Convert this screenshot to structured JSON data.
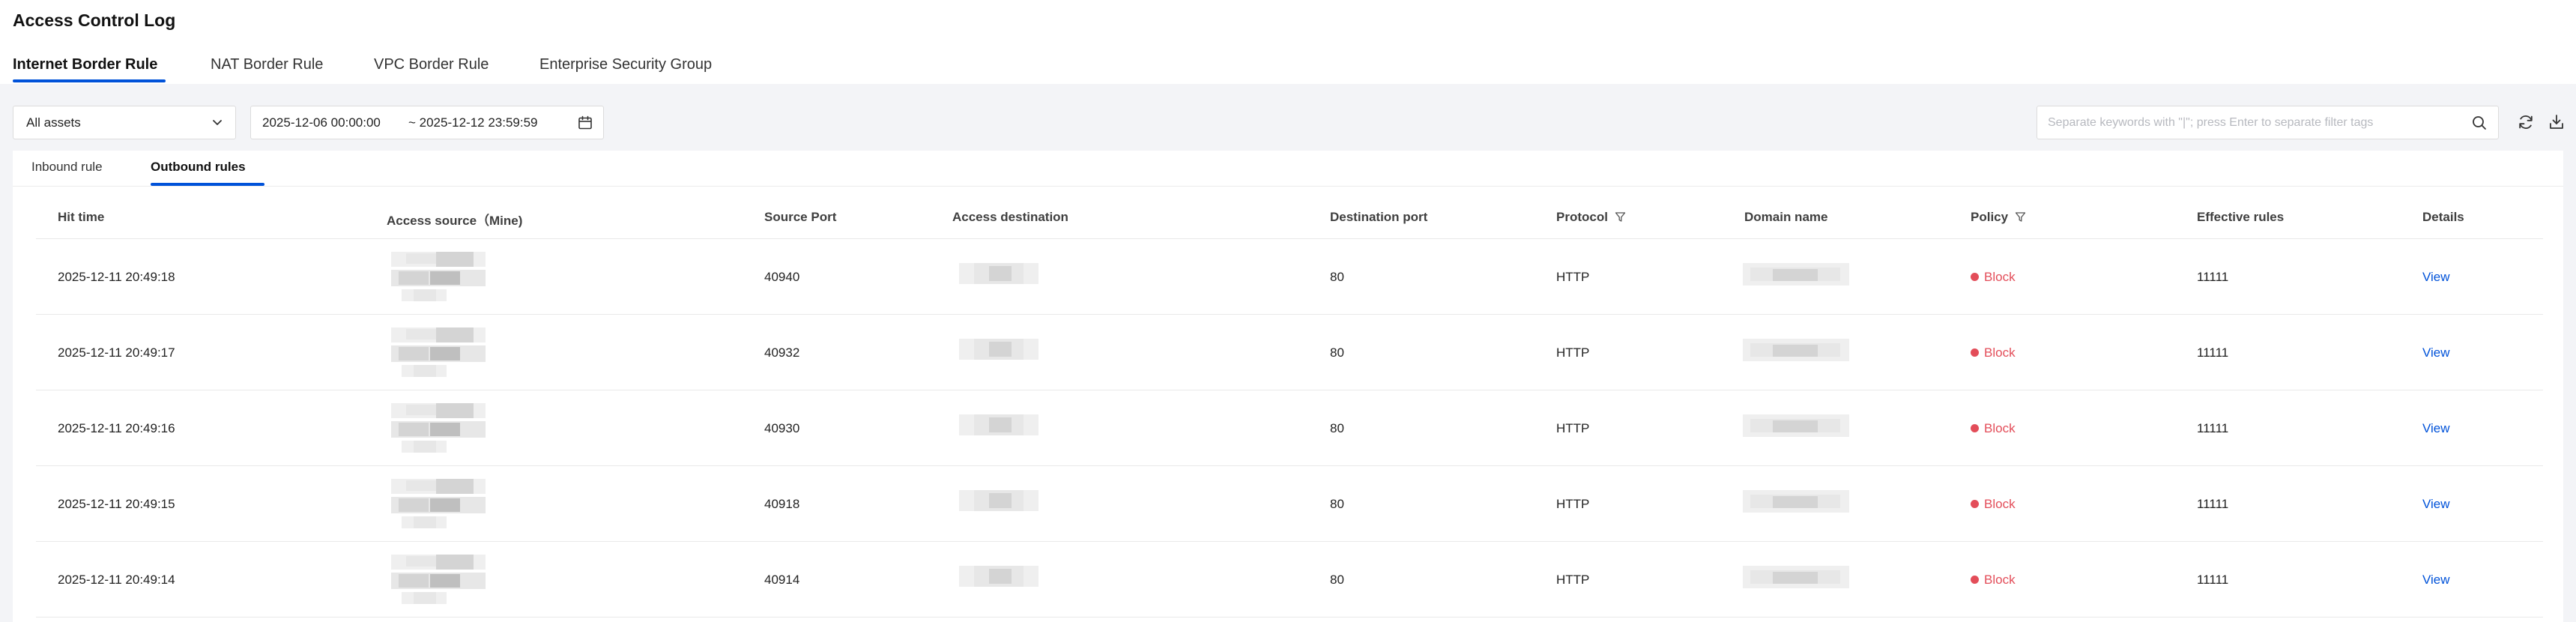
{
  "page": {
    "title": "Access Control Log"
  },
  "main_tabs": [
    {
      "label": "Internet Border Rule",
      "active": true
    },
    {
      "label": "NAT Border Rule",
      "active": false
    },
    {
      "label": "VPC Border Rule",
      "active": false
    },
    {
      "label": "Enterprise Security Group",
      "active": false
    }
  ],
  "toolbar": {
    "asset_select": "All assets",
    "date_start": "2025-12-06 00:00:00",
    "date_end": "~ 2025-12-12 23:59:59",
    "search_placeholder": "Separate keywords with \"|\"; press Enter to separate filter tags",
    "search_value": ""
  },
  "sub_tabs": [
    {
      "label": "Inbound rule",
      "active": false
    },
    {
      "label": "Outbound rules",
      "active": true
    }
  ],
  "table": {
    "columns": [
      "Hit time",
      "Access source（Mine)",
      "Source Port",
      "Access destination",
      "Destination port",
      "Protocol",
      "Domain name",
      "Policy",
      "Effective rules",
      "Details"
    ],
    "rows": [
      {
        "hit_time": "2025-12-11 20:49:18",
        "source_port": "40940",
        "dest_port": "80",
        "protocol": "HTTP",
        "policy": "Block",
        "rule": "11111",
        "details": "View"
      },
      {
        "hit_time": "2025-12-11 20:49:17",
        "source_port": "40932",
        "dest_port": "80",
        "protocol": "HTTP",
        "policy": "Block",
        "rule": "11111",
        "details": "View"
      },
      {
        "hit_time": "2025-12-11 20:49:16",
        "source_port": "40930",
        "dest_port": "80",
        "protocol": "HTTP",
        "policy": "Block",
        "rule": "11111",
        "details": "View"
      },
      {
        "hit_time": "2025-12-11 20:49:15",
        "source_port": "40918",
        "dest_port": "80",
        "protocol": "HTTP",
        "policy": "Block",
        "rule": "11111",
        "details": "View"
      },
      {
        "hit_time": "2025-12-11 20:49:14",
        "source_port": "40914",
        "dest_port": "80",
        "protocol": "HTTP",
        "policy": "Block",
        "rule": "11111",
        "details": "View"
      }
    ]
  },
  "colors": {
    "accent": "#0052d9",
    "block": "#e34d59",
    "background": "#f3f4f7"
  },
  "icons": {
    "asset_select": "chevron-down-icon",
    "date": "calendar-icon",
    "search": "search-icon",
    "refresh": "refresh-icon",
    "export": "download-icon",
    "column_filter": "filter-icon"
  }
}
